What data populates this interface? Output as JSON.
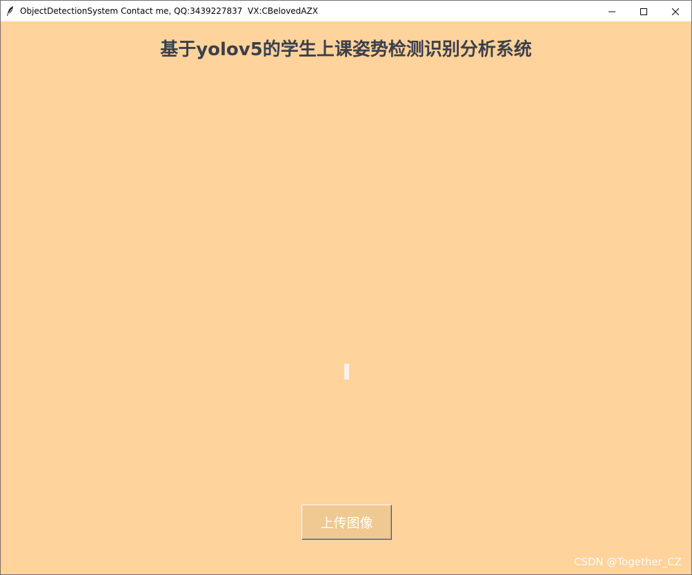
{
  "window": {
    "title": "ObjectDetectionSystem Contact me, QQ:3439227837  VX:CBelovedAZX",
    "icon": "feather-icon",
    "controls": [
      "minimize-icon",
      "maximize-icon",
      "close-icon"
    ]
  },
  "main": {
    "title": "基于yolov5的学生上课姿势检测识别分析系统",
    "upload_button_label": "上传图像"
  },
  "watermark": {
    "text": "CSDN @Together_CZ"
  },
  "colors": {
    "background": "#ffd39b",
    "title_text": "#3b3f4a",
    "button_bg": "#f0c891",
    "button_text": "#ffffff"
  }
}
